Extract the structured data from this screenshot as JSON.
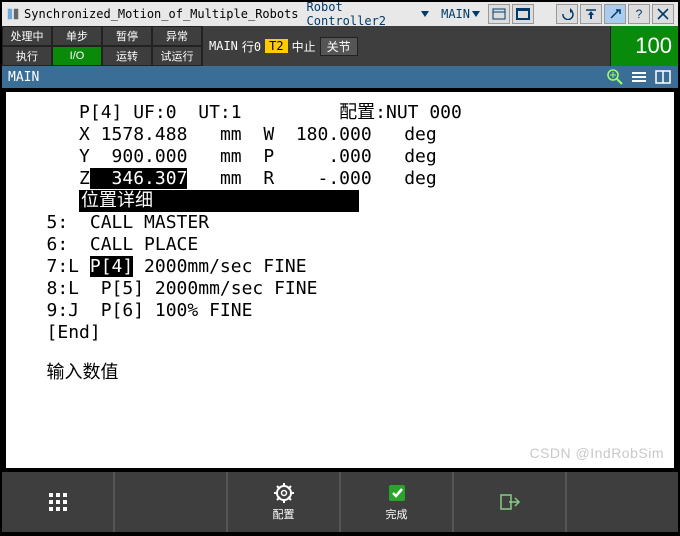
{
  "title": {
    "app": "Synchronized_Motion_of_Multiple_Robots",
    "controller": "Robot Controller2",
    "program": "MAIN"
  },
  "title_tools": {
    "view_small": "small-view",
    "view_large": "large-view",
    "undo": "undo",
    "top": "top",
    "link": "link",
    "help": "?",
    "close": "X"
  },
  "status": {
    "r1c1": "处理中",
    "r1c2": "单步",
    "r1c3": "暂停",
    "r1c4": "异常",
    "r2c1": "执行",
    "r2c2": "I/O",
    "r2c3": "运转",
    "r2c4": "试运行",
    "mid_prog": "MAIN",
    "mid_line": "行0",
    "mid_t2": "T2",
    "mid_state": "中止",
    "mid_mode": "关节",
    "speed": "100"
  },
  "header": {
    "name": "MAIN"
  },
  "pos": {
    "head": "P[4] UF:0  UT:1",
    "cfg_l": "配置:",
    "cfg_v": "NUT 000",
    "X": {
      "lbl": "X",
      "val": " 1578.488",
      "unit": "mm",
      "ax2": "W",
      "val2": "  180.000",
      "unit2": "deg"
    },
    "Y": {
      "lbl": "Y",
      "val": "  900.000",
      "unit": "mm",
      "ax2": "P",
      "val2": "     .000",
      "unit2": "deg"
    },
    "Z": {
      "lbl": "Z",
      "val": "  346.307",
      "unit": "mm",
      "ax2": "R",
      "val2": "    -.000",
      "unit2": "deg"
    },
    "detail": "位置详细"
  },
  "lines": {
    "l5": "   5:  CALL MASTER",
    "l6": "   6:  CALL PLACE",
    "l7a": "   7:L ",
    "l7p": "P[4]",
    "l7b": " 2000mm/sec FINE",
    "l8": "   8:L  P[5] 2000mm/sec FINE",
    "l9": "   9:J  P[6] 100% FINE",
    "end": "[End]"
  },
  "prompt": "输入数值",
  "watermark": "CSDN @IndRobSim",
  "bottom": {
    "b1": "",
    "b3": "配置",
    "b4": "完成",
    "b5": ""
  }
}
